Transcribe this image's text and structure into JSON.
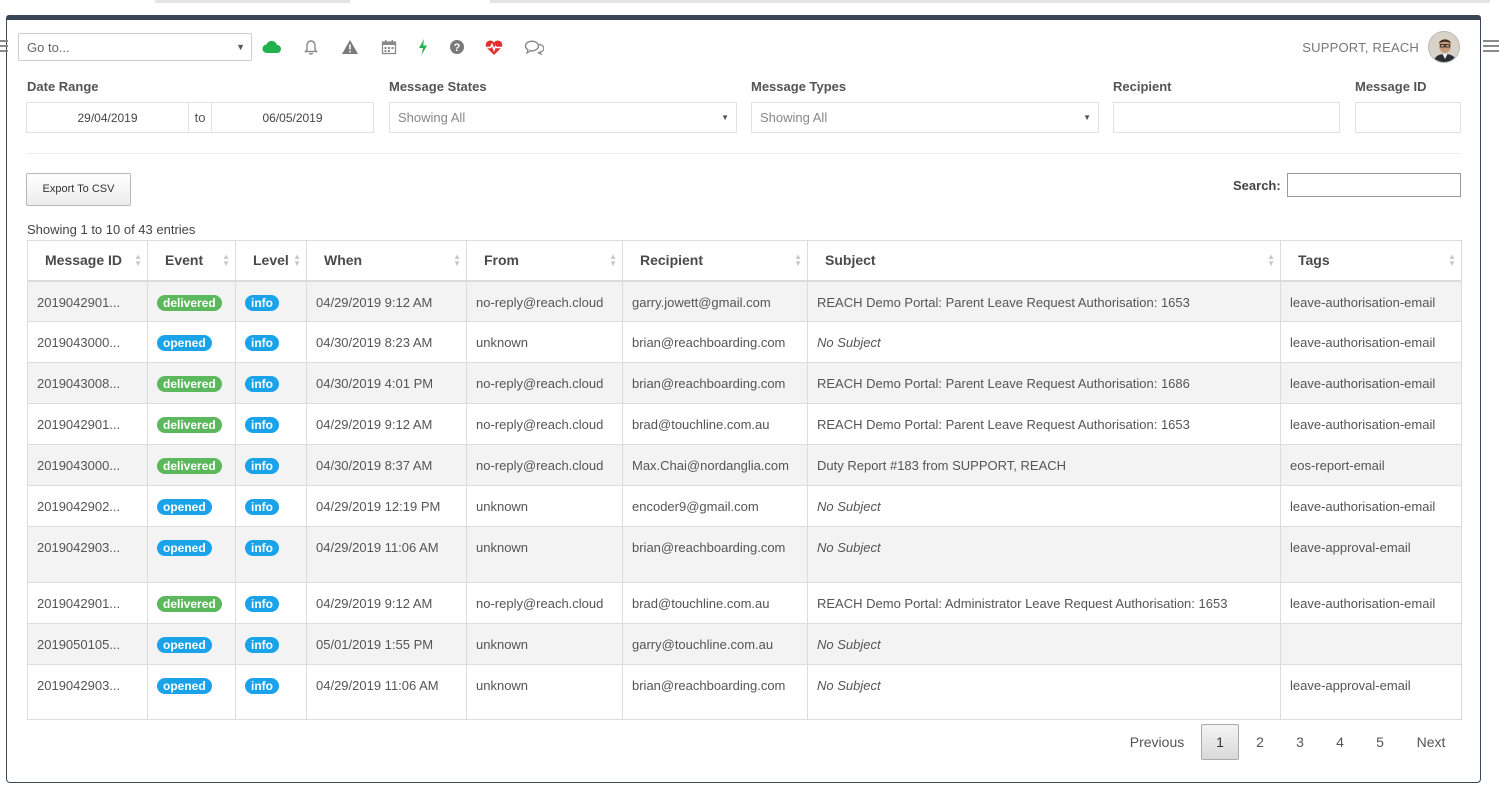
{
  "toolbar": {
    "goto_placeholder": "Go to...",
    "user_name": "SUPPORT, REACH",
    "icons": [
      "cloud-icon",
      "bell-icon",
      "warning-icon",
      "calendar-icon",
      "lightning-icon",
      "help-icon",
      "heartbeat-icon",
      "chat-icon"
    ],
    "colors": {
      "cloud": "#22b14c",
      "lightning": "#22b14c",
      "heartbeat": "#e0302b",
      "neutral": "#8a8a8a"
    }
  },
  "filters": {
    "date_range_label": "Date Range",
    "date_from": "29/04/2019",
    "to_label": "to",
    "date_to": "06/05/2019",
    "message_states_label": "Message States",
    "message_states_value": "Showing All",
    "message_types_label": "Message Types",
    "message_types_value": "Showing All",
    "recipient_label": "Recipient",
    "message_id_label": "Message ID"
  },
  "actions": {
    "export_label": "Export To CSV",
    "search_label": "Search:"
  },
  "table": {
    "summary": "Showing 1 to 10 of 43 entries",
    "columns": [
      "Message ID",
      "Event",
      "Level",
      "When",
      "From",
      "Recipient",
      "Subject",
      "Tags"
    ],
    "rows": [
      {
        "id": "2019042901...",
        "event": "delivered",
        "level": "info",
        "when": "04/29/2019 9:12 AM",
        "from": "no-reply@reach.cloud",
        "recipient": "garry.jowett@gmail.com",
        "subject": "REACH Demo Portal: Parent Leave Request Authorisation: 1653",
        "tags": "leave-authorisation-email"
      },
      {
        "id": "2019043000...",
        "event": "opened",
        "level": "info",
        "when": "04/30/2019 8:23 AM",
        "from": "unknown",
        "recipient": "brian@reachboarding.com",
        "subject": "No Subject",
        "tags": "leave-authorisation-email"
      },
      {
        "id": "2019043008...",
        "event": "delivered",
        "level": "info",
        "when": "04/30/2019 4:01 PM",
        "from": "no-reply@reach.cloud",
        "recipient": "brian@reachboarding.com",
        "subject": "REACH Demo Portal: Parent Leave Request Authorisation: 1686",
        "tags": "leave-authorisation-email"
      },
      {
        "id": "2019042901...",
        "event": "delivered",
        "level": "info",
        "when": "04/29/2019 9:12 AM",
        "from": "no-reply@reach.cloud",
        "recipient": "brad@touchline.com.au",
        "subject": "REACH Demo Portal: Parent Leave Request Authorisation: 1653",
        "tags": "leave-authorisation-email"
      },
      {
        "id": "2019043000...",
        "event": "delivered",
        "level": "info",
        "when": "04/30/2019 8:37 AM",
        "from": "no-reply@reach.cloud",
        "recipient": "Max.Chai@nordanglia.com",
        "subject": "Duty Report #183 from SUPPORT, REACH",
        "tags": "eos-report-email"
      },
      {
        "id": "2019042902...",
        "event": "opened",
        "level": "info",
        "when": "04/29/2019 12:19 PM",
        "from": "unknown",
        "recipient": "encoder9@gmail.com",
        "subject": "No Subject",
        "tags": "leave-authorisation-email"
      },
      {
        "id": "2019042903...",
        "event": "opened",
        "level": "info",
        "when": "04/29/2019 11:06 AM",
        "from": "unknown",
        "recipient": "brian@reachboarding.com",
        "subject": "No Subject",
        "tags": "leave-approval-email"
      },
      {
        "id": "2019042901...",
        "event": "delivered",
        "level": "info",
        "when": "04/29/2019 9:12 AM",
        "from": "no-reply@reach.cloud",
        "recipient": "brad@touchline.com.au",
        "subject": "REACH Demo Portal: Administrator Leave Request Authorisation: 1653",
        "tags": "leave-authorisation-email"
      },
      {
        "id": "2019050105...",
        "event": "opened",
        "level": "info",
        "when": "05/01/2019 1:55 PM",
        "from": "unknown",
        "recipient": "garry@touchline.com.au",
        "subject": "No Subject",
        "tags": ""
      },
      {
        "id": "2019042903...",
        "event": "opened",
        "level": "info",
        "when": "04/29/2019 11:06 AM",
        "from": "unknown",
        "recipient": "brian@reachboarding.com",
        "subject": "No Subject",
        "tags": "leave-approval-email"
      }
    ]
  },
  "pagination": {
    "previous": "Previous",
    "pages": [
      "1",
      "2",
      "3",
      "4",
      "5"
    ],
    "current": "1",
    "next": "Next"
  }
}
